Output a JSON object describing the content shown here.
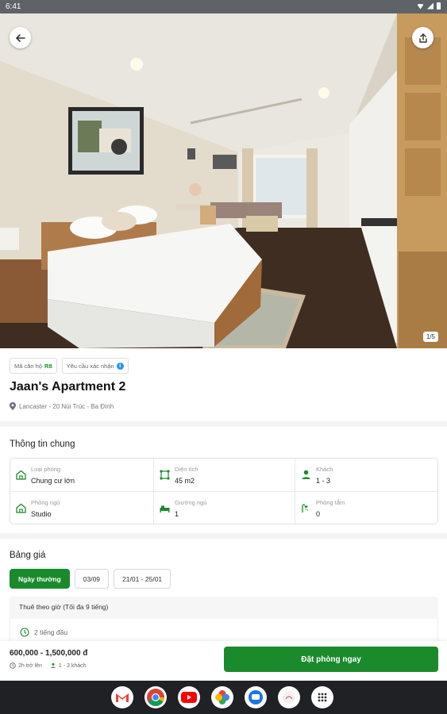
{
  "status_bar": {
    "time": "6:41"
  },
  "hero": {
    "photo_counter": "1/5"
  },
  "tags": {
    "code_label": "Mã căn hộ",
    "code_value": "R8",
    "verify_label": "Yêu cầu xác nhận"
  },
  "listing": {
    "title": "Jaan's Apartment 2",
    "address": "Lancaster - 20 Núi Trúc - Ba Đình"
  },
  "general_info": {
    "title": "Thông tin chung",
    "items": [
      {
        "label": "Loại phòng",
        "value": "Chung cư lớn",
        "icon": "home-icon"
      },
      {
        "label": "Diện tích",
        "value": "45 m2",
        "icon": "area-icon"
      },
      {
        "label": "Khách",
        "value": "1 - 3",
        "icon": "person-icon"
      },
      {
        "label": "Phòng ngủ",
        "value": "Studio",
        "icon": "home-icon"
      },
      {
        "label": "Giường ngủ",
        "value": "1",
        "icon": "bed-icon"
      },
      {
        "label": "Phòng tắm",
        "value": "0",
        "icon": "shower-icon"
      }
    ]
  },
  "pricing": {
    "title": "Bảng giá",
    "tabs": [
      "Ngày thường",
      "03/09",
      "21/01 - 25/01"
    ],
    "rent_header": "Thuê theo giờ (Tối đa 9 tiếng)",
    "first_row": "2 tiếng đầu"
  },
  "bottom_bar": {
    "price_range": "600,000 - 1,500,000 đ",
    "duration": "2h trở lên",
    "guests": "1 - 3 khách",
    "book_label": "Đặt phòng ngay"
  },
  "colors": {
    "accent": "#1b8a2c",
    "info": "#2196f3"
  }
}
